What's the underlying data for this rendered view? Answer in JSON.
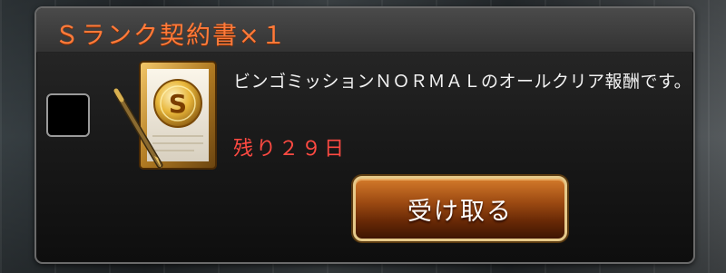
{
  "dialog": {
    "title": "Ｓランク契約書×１",
    "description": "ビンゴミッションＮＯＲＭＡＬのオールクリア報酬です。",
    "remaining": "残り２９日",
    "receive_label": "受け取る",
    "item_icon": "s-rank-contract-icon",
    "colors": {
      "title": "#ff7a3a",
      "remaining": "#ff4a42",
      "button": "#9c4a12"
    }
  }
}
